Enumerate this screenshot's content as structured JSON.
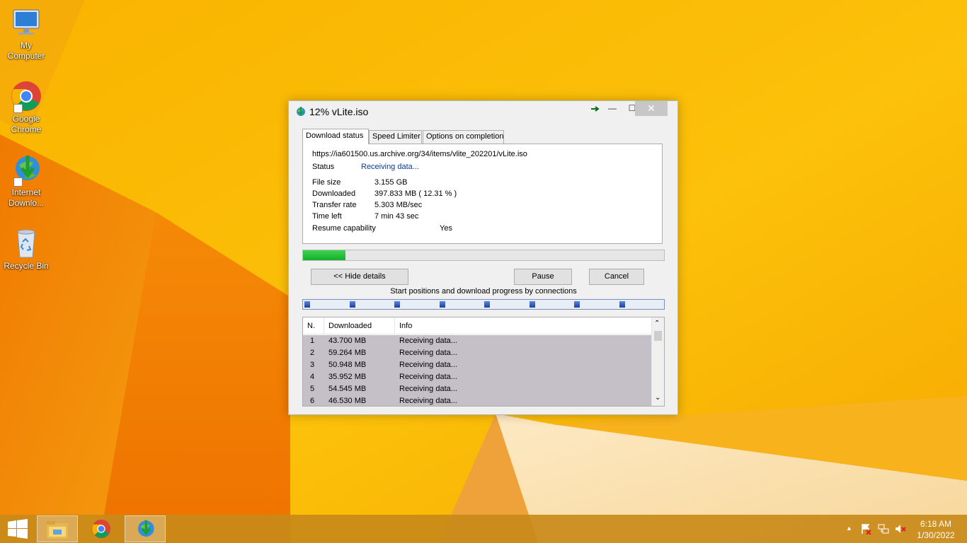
{
  "desktop": {
    "icons": [
      {
        "label_line1": "My",
        "label_line2": "Computer",
        "icon": "my-computer-icon"
      },
      {
        "label_line1": "Google",
        "label_line2": "Chrome",
        "icon": "chrome-icon"
      },
      {
        "label_line1": "Internet",
        "label_line2": "Downlo...",
        "icon": "idm-icon"
      },
      {
        "label_line1": "Recycle Bin",
        "label_line2": "",
        "icon": "recycle-bin-icon"
      }
    ]
  },
  "window": {
    "title": "12% vLite.iso",
    "close_glyph": "✕",
    "minimize_glyph": "—",
    "maximize_glyph": "☐",
    "tabs": [
      "Download status",
      "Speed Limiter",
      "Options on completion"
    ],
    "active_tab": "Download status",
    "url": "https://ia601500.us.archive.org/34/items/vlite_202201/vLite.iso",
    "status_label": "Status",
    "status_value": "Receiving data...",
    "fields": [
      {
        "label": "File size",
        "value": "3.155  GB"
      },
      {
        "label": "Downloaded",
        "value": "397.833  MB  ( 12.31 % )"
      },
      {
        "label": "Transfer rate",
        "value": "5.303  MB/sec"
      },
      {
        "label": "Time left",
        "value": "7 min 43 sec"
      },
      {
        "label": "Resume capability",
        "value": "Yes"
      }
    ],
    "progress_percent": 12.31,
    "buttons": {
      "hide_details": "<< Hide details",
      "pause": "Pause",
      "cancel": "Cancel"
    },
    "connections_caption": "Start positions and download progress by connections",
    "connection_marks_count": 8,
    "list": {
      "columns": [
        "N.",
        "Downloaded",
        "Info"
      ],
      "rows": [
        {
          "n": "1",
          "downloaded": "43.700  MB",
          "info": "Receiving data..."
        },
        {
          "n": "2",
          "downloaded": "59.264  MB",
          "info": "Receiving data..."
        },
        {
          "n": "3",
          "downloaded": "50.948  MB",
          "info": "Receiving data..."
        },
        {
          "n": "4",
          "downloaded": "35.952  MB",
          "info": "Receiving data..."
        },
        {
          "n": "5",
          "downloaded": "54.545  MB",
          "info": "Receiving data..."
        },
        {
          "n": "6",
          "downloaded": "46.530  MB",
          "info": "Receiving data..."
        }
      ]
    }
  },
  "taskbar": {
    "time": "6:18 AM",
    "date": "1/30/2022",
    "items": [
      "start-button",
      "file-explorer",
      "chrome",
      "internet-download-manager"
    ]
  },
  "colors": {
    "wallpaper_base": "#f7b800",
    "progress_green": "#13b02b",
    "status_blue": "#0b3b91",
    "list_selection": "#c5bfc8",
    "taskbar": "#c98a19"
  }
}
